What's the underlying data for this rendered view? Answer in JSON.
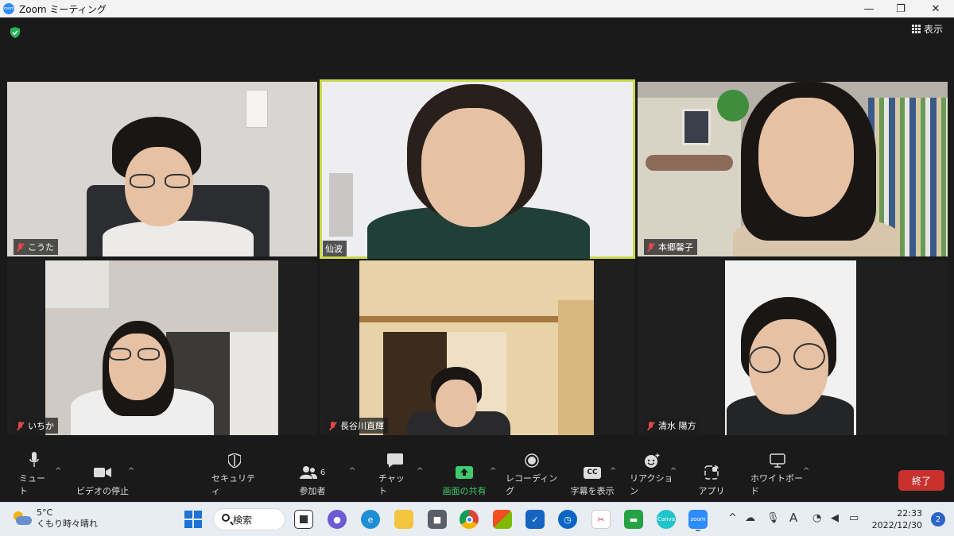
{
  "window": {
    "app_icon_text": "zoom",
    "title": "Zoom ミーティング",
    "minimize": "—",
    "restore": "❐",
    "close": "✕"
  },
  "meeting": {
    "view_label": "表示",
    "active_speaker": "仙波",
    "participants": [
      {
        "name": "こうた",
        "muted": true
      },
      {
        "name": "仙波",
        "muted": false
      },
      {
        "name": "本郷馨子",
        "muted": true
      },
      {
        "name": "いちか",
        "muted": true
      },
      {
        "name": "長谷川直輝",
        "muted": true
      },
      {
        "name": "清水 陽方",
        "muted": true
      }
    ]
  },
  "toolbar": {
    "mute": "ミュート",
    "video": "ビデオの停止",
    "security": "セキュリティ",
    "participants": "参加者",
    "participants_count": "6",
    "chat": "チャット",
    "share": "画面の共有",
    "record": "レコーディング",
    "captions": "字幕を表示",
    "captions_icon": "CC",
    "reactions": "リアクション",
    "apps": "アプリ",
    "whiteboard": "ホワイトボード",
    "end": "終了",
    "share_color": "#3fca6b",
    "end_color": "#c8312e"
  },
  "taskbar": {
    "temperature": "5°C",
    "weather": "くもり時々晴れ",
    "search": "検索",
    "canva_label": "Canva",
    "zoom_label": "zoom",
    "time": "22:33",
    "date": "2022/12/30",
    "notifications": "2",
    "ime": "A"
  }
}
